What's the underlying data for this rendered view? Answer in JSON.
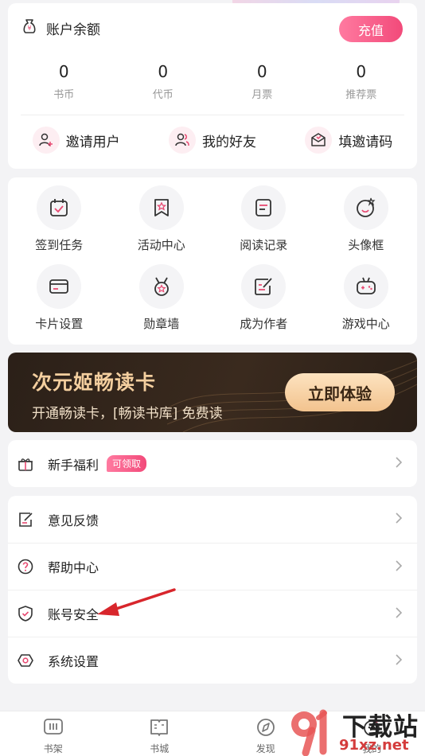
{
  "account": {
    "title": "账户余额",
    "recharge_label": "充值",
    "stats": [
      {
        "value": "0",
        "label": "书币"
      },
      {
        "value": "0",
        "label": "代币"
      },
      {
        "value": "0",
        "label": "月票"
      },
      {
        "value": "0",
        "label": "推荐票"
      }
    ],
    "invites": [
      {
        "label": "邀请用户",
        "icon": "add-user-icon"
      },
      {
        "label": "我的好友",
        "icon": "friends-icon"
      },
      {
        "label": "填邀请码",
        "icon": "envelope-icon"
      }
    ]
  },
  "features": [
    {
      "label": "签到任务",
      "icon": "calendar-check-icon"
    },
    {
      "label": "活动中心",
      "icon": "bookmark-star-icon"
    },
    {
      "label": "阅读记录",
      "icon": "document-icon"
    },
    {
      "label": "头像框",
      "icon": "avatar-frame-icon"
    },
    {
      "label": "卡片设置",
      "icon": "card-icon"
    },
    {
      "label": "勋章墙",
      "icon": "medal-icon"
    },
    {
      "label": "成为作者",
      "icon": "pen-edit-icon"
    },
    {
      "label": "游戏中心",
      "icon": "gamepad-icon"
    }
  ],
  "vip": {
    "title": "次元姬畅读卡",
    "subtitle": "开通畅读卡，[畅读书库] 免费读",
    "button_label": "立即体验"
  },
  "newbie": {
    "label": "新手福利",
    "badge": "可领取"
  },
  "menu": [
    {
      "label": "意见反馈",
      "icon": "feedback-icon"
    },
    {
      "label": "帮助中心",
      "icon": "help-icon"
    },
    {
      "label": "账号安全",
      "icon": "shield-icon"
    },
    {
      "label": "系统设置",
      "icon": "settings-icon"
    }
  ],
  "tabs": [
    {
      "label": "书架",
      "icon": "bookshelf-icon"
    },
    {
      "label": "书城",
      "icon": "book-store-icon"
    },
    {
      "label": "发现",
      "icon": "compass-icon"
    },
    {
      "label": "我的",
      "icon": "profile-icon"
    }
  ],
  "watermark": {
    "text": "下载站",
    "url": "91xz.net"
  },
  "colors": {
    "accent": "#f24a7a",
    "vip_bg": "#2b2018",
    "vip_gold": "#f4cf9f"
  }
}
